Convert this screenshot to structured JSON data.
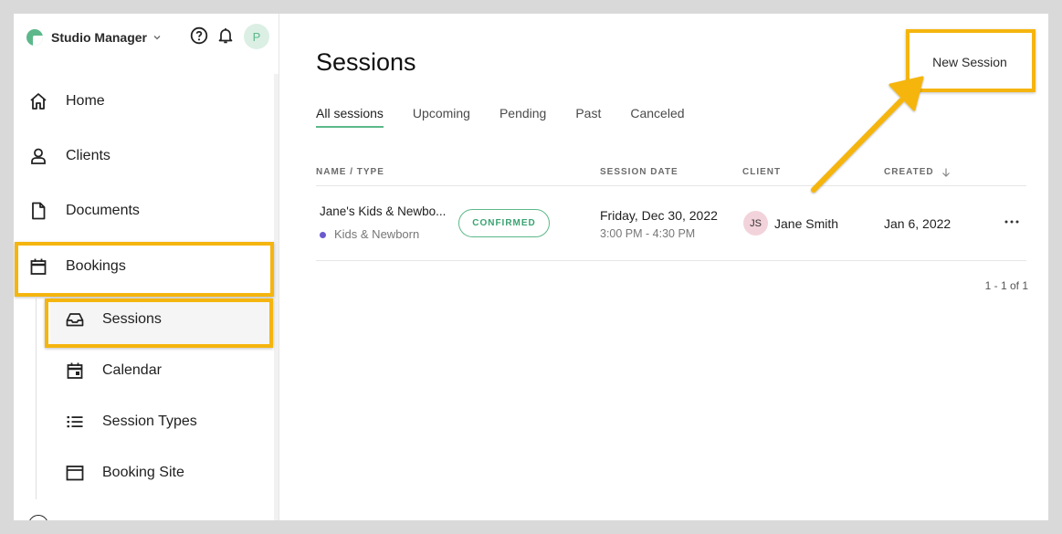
{
  "app": {
    "brand": "Studio Manager",
    "avatar_initial": "P"
  },
  "sidebar": {
    "items": [
      {
        "label": "Home",
        "icon": "home-icon"
      },
      {
        "label": "Clients",
        "icon": "person-icon"
      },
      {
        "label": "Documents",
        "icon": "document-icon"
      },
      {
        "label": "Bookings",
        "icon": "calendar-icon"
      }
    ],
    "sub_items": [
      {
        "label": "Sessions",
        "icon": "inbox-icon",
        "active": true
      },
      {
        "label": "Calendar",
        "icon": "calendar-day-icon"
      },
      {
        "label": "Session Types",
        "icon": "list-icon"
      },
      {
        "label": "Booking Site",
        "icon": "browser-window-icon"
      }
    ]
  },
  "page": {
    "title": "Sessions",
    "new_button": "New Session",
    "tabs": [
      "All sessions",
      "Upcoming",
      "Pending",
      "Past",
      "Canceled"
    ],
    "active_tab": "All sessions"
  },
  "table": {
    "headers": {
      "name": "NAME / TYPE",
      "date": "SESSION DATE",
      "client": "CLIENT",
      "created": "CREATED"
    },
    "rows": [
      {
        "name": "Jane's Kids & Newbo...",
        "type": "Kids & Newborn",
        "status": "CONFIRMED",
        "date": "Friday, Dec 30, 2022",
        "time": "3:00 PM - 4:30 PM",
        "client_initials": "JS",
        "client": "Jane Smith",
        "created": "Jan 6, 2022"
      }
    ],
    "pagination": "1 - 1 of 1"
  },
  "colors": {
    "accent": "#5cb88a",
    "highlight": "#f5b50f",
    "type_dot": "#6a5acd"
  }
}
